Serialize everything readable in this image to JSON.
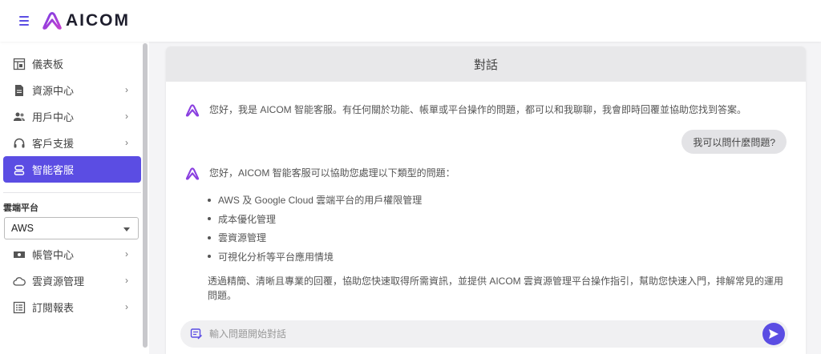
{
  "header": {
    "logo_text": "AICOM"
  },
  "sidebar": {
    "items": [
      {
        "label": "儀表板",
        "icon": "dashboard-icon",
        "has_children": false
      },
      {
        "label": "資源中心",
        "icon": "document-icon",
        "has_children": true
      },
      {
        "label": "用戶中心",
        "icon": "users-icon",
        "has_children": true
      },
      {
        "label": "客戶支援",
        "icon": "headset-icon",
        "has_children": true
      },
      {
        "label": "智能客服",
        "icon": "bot-icon",
        "has_children": false,
        "active": true
      }
    ],
    "cloud_section_label": "雲端平台",
    "cloud_select_value": "AWS",
    "cloud_items": [
      {
        "label": "帳管中心",
        "icon": "billing-icon",
        "has_children": true
      },
      {
        "label": "雲資源管理",
        "icon": "cloud-icon",
        "has_children": true
      },
      {
        "label": "訂閱報表",
        "icon": "report-icon",
        "has_children": true
      }
    ]
  },
  "chat": {
    "title": "對話",
    "bot_greeting": "您好，我是 AICOM 智能客服。有任何關於功能、帳單或平台操作的問題，都可以和我聊聊，我會即時回覆並協助您找到答案。",
    "user_message": "我可以問什麼問題?",
    "bot_reply_intro": "您好，AICOM 智能客服可以協助您處理以下類型的問題：",
    "bot_reply_list": [
      "AWS 及 Google Cloud 雲端平台的用戶權限管理",
      "成本優化管理",
      "雲資源管理",
      "可視化分析等平台應用情境"
    ],
    "bot_reply_closing": "透過精簡、清晰且專業的回覆，協助您快速取得所需資訊，並提供 AICOM 雲資源管理平台操作指引，幫助您快速入門，排解常見的運用問題。",
    "input_placeholder": "輸入問題開始對話"
  },
  "colors": {
    "accent": "#5b4de3",
    "header_bg": "#e8e8ea",
    "bubble_bg": "#e3e3e6"
  }
}
